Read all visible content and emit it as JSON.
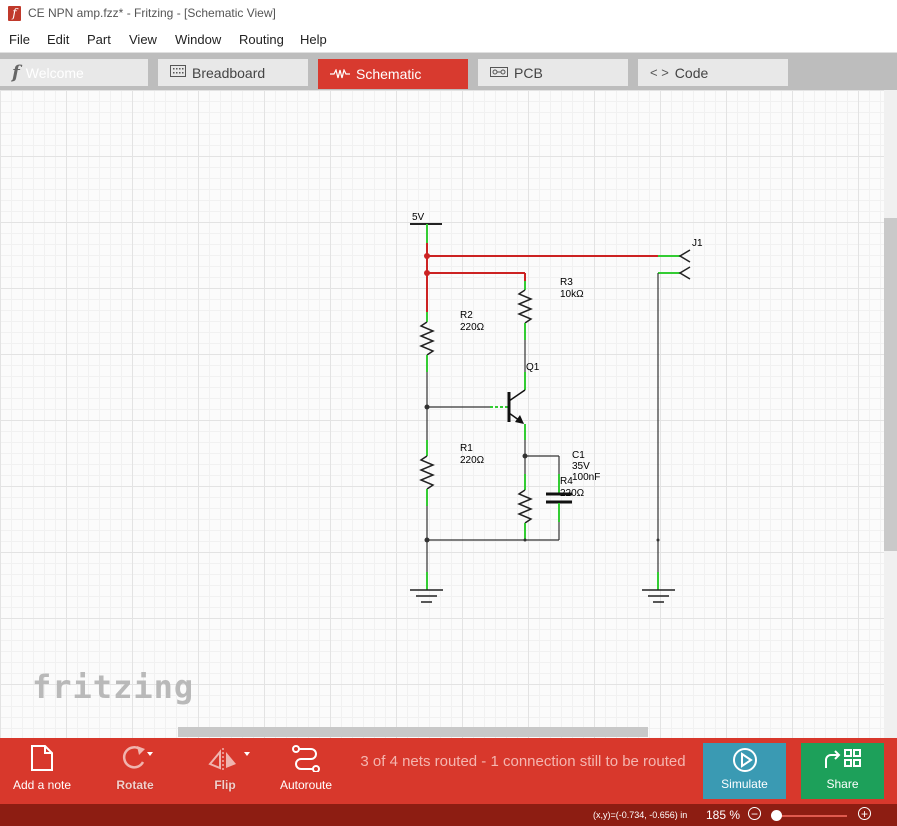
{
  "window": {
    "title": "CE NPN amp.fzz* - Fritzing - [Schematic View]"
  },
  "menu": [
    "File",
    "Edit",
    "Part",
    "View",
    "Window",
    "Routing",
    "Help"
  ],
  "tabs": [
    {
      "label": "Welcome",
      "icon": "fritzing-f-icon",
      "active": false
    },
    {
      "label": "Breadboard",
      "icon": "breadboard-icon",
      "active": false
    },
    {
      "label": "Schematic",
      "icon": "schematic-icon",
      "active": true
    },
    {
      "label": "PCB",
      "icon": "pcb-icon",
      "active": false
    },
    {
      "label": "Code",
      "icon": "code-icon",
      "active": false
    }
  ],
  "schematic": {
    "power_label": "5V",
    "connector_label": "J1",
    "r3": {
      "name": "R3",
      "value": "10kΩ"
    },
    "r2": {
      "name": "R2",
      "value": "220Ω"
    },
    "q1": {
      "name": "Q1"
    },
    "r1": {
      "name": "R1",
      "value": "220Ω"
    },
    "c1": {
      "name": "C1",
      "voltage": "35V",
      "value": "100nF"
    },
    "r4": {
      "name": "R4",
      "value": "220Ω"
    }
  },
  "logo": "fritzing",
  "toolbar": {
    "add_note": "Add a note",
    "rotate": "Rotate",
    "flip": "Flip",
    "autoroute": "Autoroute",
    "status_message": "3 of 4 nets routed - 1 connection still to be routed",
    "simulate": "Simulate",
    "share": "Share"
  },
  "statusbar": {
    "coordinates": "(x,y)=(-0.734, -0.656) in",
    "zoom": "185 %"
  },
  "colors": {
    "accent": "#d8382c",
    "simulate": "#3a9ab3",
    "share": "#1da05a",
    "wire_routed": "#cc2222",
    "wire_normal": "#333333",
    "pin_highlight": "#33cc33"
  }
}
